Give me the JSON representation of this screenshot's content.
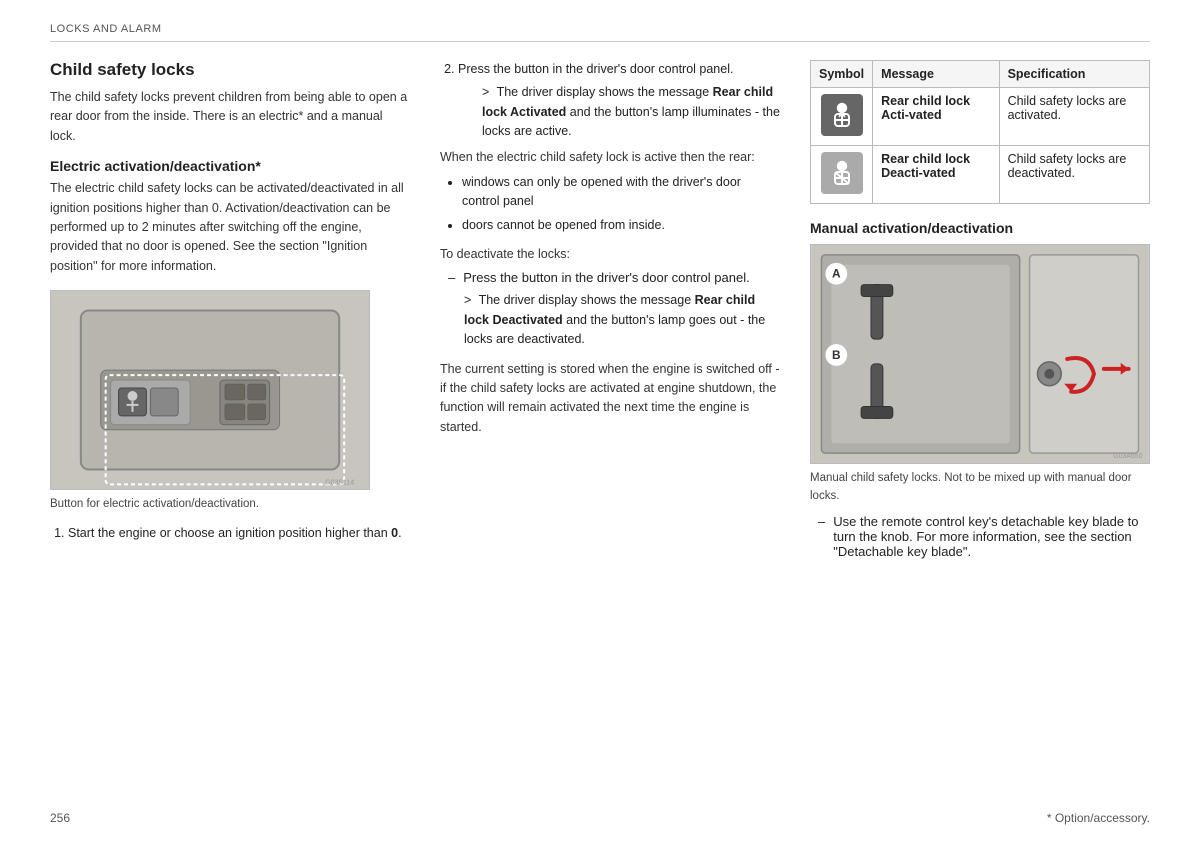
{
  "header": {
    "title": "LOCKS AND ALARM"
  },
  "left": {
    "section_title": "Child safety locks",
    "intro": "The child safety locks prevent children from being able to open a rear door from the inside. There is an electric* and a manual lock.",
    "sub_title": "Electric activation/deactivation*",
    "electric_desc": "The electric child safety locks can be activated/deactivated in all ignition positions higher than 0. Activation/deactivation can be performed up to 2 minutes after switching off the engine, provided that no door is opened. See the section \"Ignition position\" for more information.",
    "image_caption": "Button for electric activation/deactivation.",
    "step1": "Start the engine or choose an ignition position higher than",
    "step1_bold": "0",
    "step1_period": "."
  },
  "center": {
    "step2": "Press the button in the driver's door control panel.",
    "step2_sub": "The driver display shows the message",
    "step2_sub_bold": "Rear child lock Activated",
    "step2_sub_rest": " and the button's lamp illuminates - the locks are active.",
    "when_active": "When the electric child safety lock is active then the rear:",
    "bullet1": "windows can only be opened with the driver's door control panel",
    "bullet2": "doors cannot be opened from inside.",
    "deactivate_intro": "To deactivate the locks:",
    "dash1": "Press the button in the driver's door control panel.",
    "dash1_sub": "The driver display shows the message",
    "dash1_sub_bold": "Rear child lock Deactivated",
    "dash1_sub_rest": " and the button's lamp goes out - the locks are deactivated.",
    "stored_text": "The current setting is stored when the engine is switched off - if the child safety locks are activated at engine shutdown, the function will remain activated the next time the engine is started."
  },
  "right": {
    "table": {
      "col_symbol": "Symbol",
      "col_message": "Message",
      "col_spec": "Specification",
      "row1": {
        "message_bold": "Rear child lock Acti-vated",
        "spec": "Child safety locks are activated."
      },
      "row2": {
        "message_bold": "Rear child lock Deacti-vated",
        "spec": "Child safety locks are deactivated."
      }
    },
    "manual_title": "Manual activation/deactivation",
    "manual_caption": "Manual child safety locks. Not to be mixed up with manual door locks.",
    "dash_text": "Use the remote control key's detachable key blade to turn the knob. For more information, see the section \"Detachable key blade\"."
  },
  "footer": {
    "page_number": "256",
    "footnote": "* Option/accessory."
  }
}
